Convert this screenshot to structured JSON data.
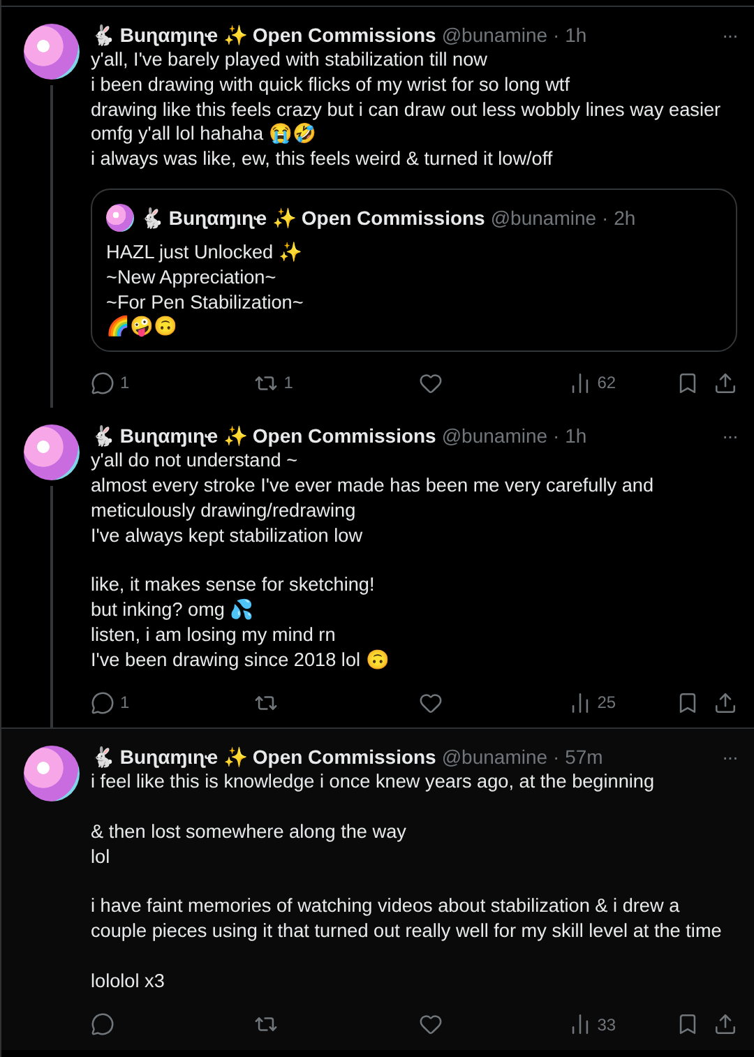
{
  "tweets": [
    {
      "author": {
        "name": "🐇 Buɳαɱιɳҽ ✨ Open Commissions",
        "handle": "@bunamine",
        "time": "· 1h"
      },
      "more": "···",
      "text": "y'all, I've barely played with stabilization till now\ni been drawing with quick flicks of my wrist for so long wtf\ndrawing like this feels crazy but i can draw out less wobbly lines way easier\nomfg y'all lol hahaha 😭🤣\ni always was like, ew, this feels weird & turned it low/off",
      "quote": {
        "author": {
          "name": "🐇 Buɳαɱιɳҽ ✨ Open Commissions",
          "handle": "@bunamine",
          "time": "· 2h"
        },
        "text": "HAZL just Unlocked ✨\n~New Appreciation~\n~For Pen Stabilization~\n🌈🤪🙃"
      },
      "actions": {
        "replies": "1",
        "reposts": "1",
        "views": "62"
      },
      "thread_continues": true,
      "highlighted": false
    },
    {
      "author": {
        "name": "🐇 Buɳαɱιɳҽ ✨ Open Commissions",
        "handle": "@bunamine",
        "time": "· 1h"
      },
      "more": "···",
      "text": "y'all do not understand ~\nalmost every stroke I've ever made has been me very carefully and meticulously drawing/redrawing\nI've always kept stabilization low\n\nlike, it makes sense for sketching!\nbut inking? omg 💦\nlisten, i am losing my mind rn\nI've been drawing since 2018 lol 🙃",
      "actions": {
        "replies": "1",
        "views": "25"
      },
      "thread_continues": true,
      "highlighted": false
    },
    {
      "author": {
        "name": "🐇 Buɳαɱιɳҽ ✨ Open Commissions",
        "handle": "@bunamine",
        "time": "· 57m"
      },
      "more": "···",
      "text": "i feel like this is knowledge i once knew years ago, at the beginning\n\n& then lost somewhere along the way\nlol\n\ni have faint memories of watching videos about stabilization & i drew a couple pieces using it that turned out really well for my skill level at the time\n\nlololol x3",
      "actions": {
        "views": "33"
      },
      "thread_continues": false,
      "highlighted": true
    }
  ]
}
